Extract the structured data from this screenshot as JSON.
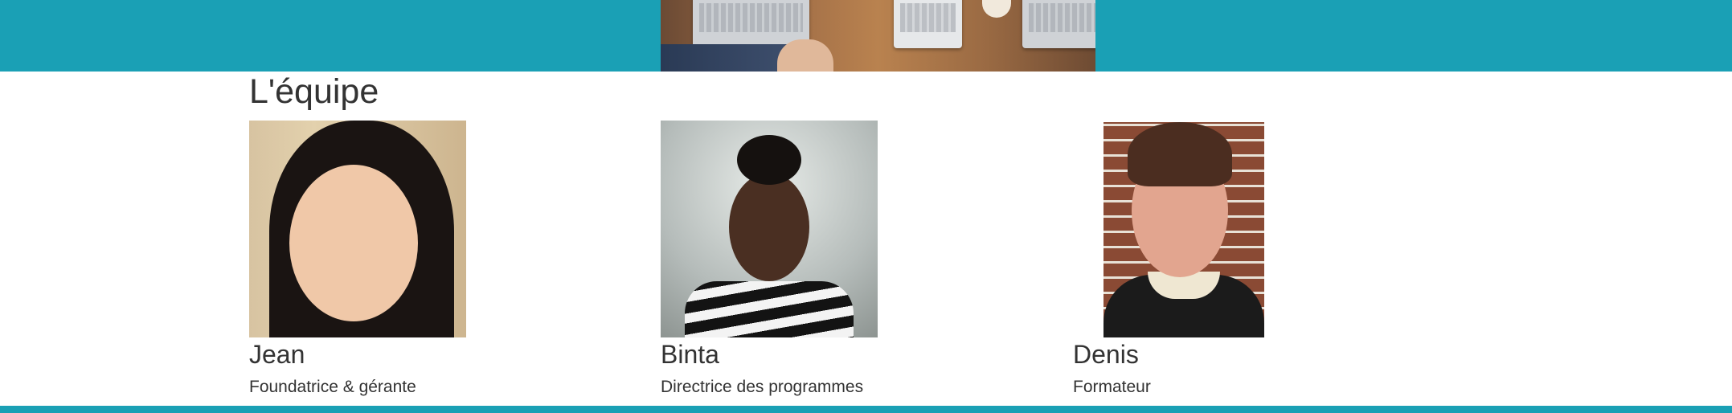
{
  "team": {
    "heading": "L'équipe",
    "members": [
      {
        "name": "Jean",
        "role": "Foundatrice & gérante"
      },
      {
        "name": "Binta",
        "role": "Directrice des programmes"
      },
      {
        "name": "Denis",
        "role": "Formateur"
      }
    ]
  },
  "colors": {
    "accent": "#1aa0b5",
    "text": "#333333",
    "background": "#ffffff"
  }
}
